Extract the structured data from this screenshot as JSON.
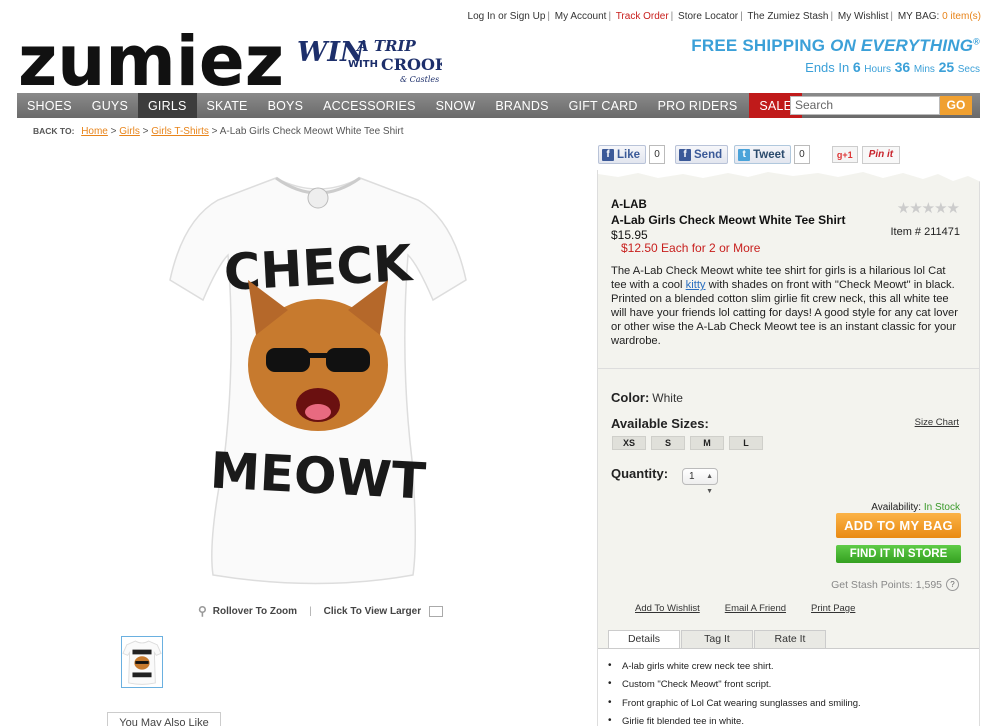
{
  "util_links": {
    "login": "Log In or Sign Up",
    "account": "My Account",
    "track": "Track Order",
    "store": "Store Locator",
    "stash": "The Zumiez Stash",
    "wishlist": "My Wishlist",
    "bag_label": "MY BAG:",
    "bag_count": "0 item(s)"
  },
  "logo": "zumiez",
  "promo": {
    "line1": "WIN",
    "line2": "A TRIP",
    "line3": "WITH",
    "line4": "CROOKS",
    "line5": "& Castles"
  },
  "shipping": {
    "headline_a": "FREE SHIPPING",
    "headline_b": "ON EVERYTHING",
    "ends": "Ends In",
    "hours": "6",
    "hours_lbl": "Hours",
    "mins": "36",
    "mins_lbl": "Mins",
    "secs": "25",
    "secs_lbl": "Secs"
  },
  "nav": {
    "items": [
      "SHOES",
      "GUYS",
      "GIRLS",
      "SKATE",
      "BOYS",
      "ACCESSORIES",
      "SNOW",
      "BRANDS",
      "GIFT CARD",
      "PRO RIDERS"
    ],
    "sale": "SALE",
    "search_placeholder": "Search",
    "search_btn": "GO"
  },
  "breadcrumb": {
    "back": "BACK TO:",
    "home": "Home",
    "girls": "Girls",
    "tshirts": "Girls T-Shirts",
    "current": "A-Lab Girls Check Meowt White Tee Shirt"
  },
  "image": {
    "shirt_text_top": "CHECK",
    "shirt_text_bottom": "MEOWT",
    "zoom": "Rollover To Zoom",
    "larger": "Click To View Larger"
  },
  "you_may_also_like": "You May Also Like",
  "social": {
    "like": "Like",
    "like_count": "0",
    "send": "Send",
    "tweet": "Tweet",
    "tweet_count": "0",
    "gplus": "+1",
    "pin": "Pin it"
  },
  "product": {
    "brand": "A-LAB",
    "title": "A-Lab Girls Check Meowt White Tee Shirt",
    "price": "$15.95",
    "multi_price": "$12.50 Each for 2 or More",
    "rating_stars": "★★★★★",
    "item_no": "Item # 211471",
    "desc_a": "The A-Lab Check Meowt white tee shirt for girls is a hilarious lol Cat tee with a cool ",
    "desc_link": "kitty",
    "desc_b": " with shades on front with \"Check Meowt\" in black. Printed on a blended cotton slim girlie fit crew neck, this all white tee will have your friends lol catting for days! A good style for any cat lover or other wise the A-Lab Check Meowt tee is an instant classic for your wardrobe.",
    "color_label": "Color:",
    "color_value": "White",
    "sizes_label": "Available Sizes:",
    "size_chart": "Size Chart",
    "sizes": [
      "XS",
      "S",
      "M",
      "L"
    ],
    "qty_label": "Quantity:",
    "qty_value": "1",
    "avail_label": "Availability:",
    "avail_value": "In Stock",
    "add_bag": "ADD TO MY BAG",
    "find_store": "FIND IT IN STORE",
    "stash_points": "Get Stash Points: 1,595",
    "add_wishlist": "Add To Wishlist",
    "email_friend": "Email A Friend",
    "print_page": "Print Page"
  },
  "tabs": [
    "Details",
    "Tag It",
    "Rate It"
  ],
  "details": [
    "A-lab girls white crew neck tee shirt.",
    "Custom \"Check Meowt\" front script.",
    "Front graphic of Lol Cat wearing sunglasses and smiling.",
    "Girlie fit blended tee in white."
  ]
}
